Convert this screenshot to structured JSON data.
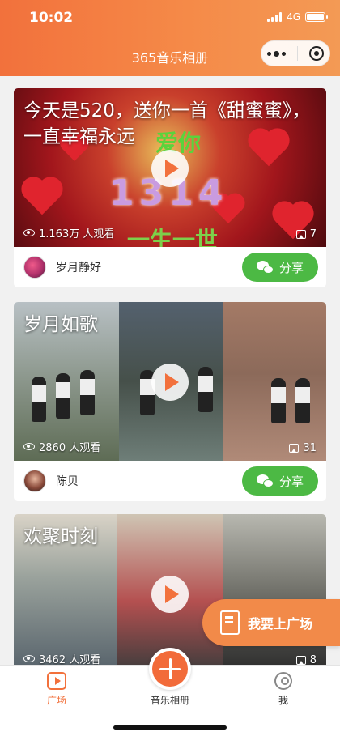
{
  "status_bar": {
    "time": "10:02",
    "network": "4G"
  },
  "header": {
    "title": "365音乐相册"
  },
  "cards": [
    {
      "title": "今天是520，送你一首《甜蜜蜜》，一直幸福永远",
      "overlay": {
        "big": "1314",
        "top": "爱你",
        "bottom": "一生一世"
      },
      "views": "1.163万 人观看",
      "photos": "7",
      "author": "岁月静好",
      "share_label": "分享"
    },
    {
      "title": "岁月如歌",
      "views": "2860 人观看",
      "photos": "31",
      "author": "陈贝",
      "share_label": "分享"
    },
    {
      "title": "欢聚时刻",
      "views": "3462 人观看",
      "photos": "8"
    }
  ],
  "floating_cta": {
    "label": "我要上广场"
  },
  "tabbar": {
    "items": [
      {
        "label": "广场"
      },
      {
        "label": "音乐相册"
      },
      {
        "label": "我"
      }
    ]
  },
  "colors": {
    "accent": "#f2713c",
    "share_green": "#4cb944"
  }
}
